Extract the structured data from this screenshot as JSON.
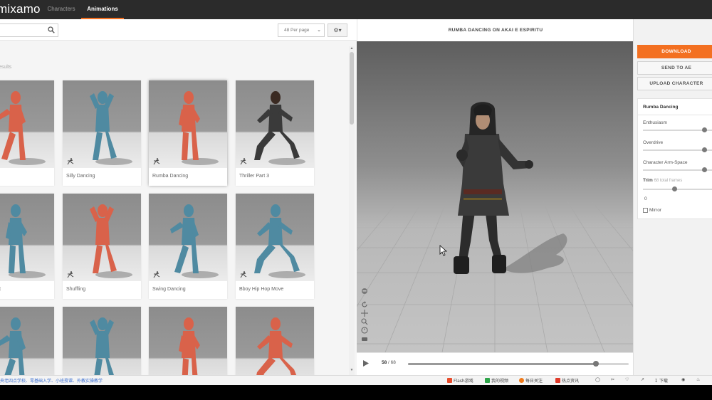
{
  "app": {
    "logo": "mixamo",
    "nav": [
      {
        "label": "Characters"
      },
      {
        "label": "Animations"
      }
    ]
  },
  "library": {
    "search_value": "",
    "per_page": "48 Per page",
    "results_label": "esults",
    "cards": [
      {
        "label": "Dancing",
        "tint": "orange",
        "pose": "lean"
      },
      {
        "label": "Silly Dancing",
        "tint": "blue",
        "pose": "arms-up"
      },
      {
        "label": "Rumba Dancing",
        "tint": "orange",
        "pose": "stand",
        "selected": true
      },
      {
        "label": "Thriller Part 3",
        "tint": "human",
        "pose": "crouch"
      },
      {
        "label": "rock Start",
        "tint": "blue",
        "pose": "stand"
      },
      {
        "label": "Shuffling",
        "tint": "orange",
        "pose": "arms-up"
      },
      {
        "label": "Swing Dancing",
        "tint": "blue",
        "pose": "lean"
      },
      {
        "label": "Bboy Hip Hop Move",
        "tint": "blue",
        "pose": "crouch"
      },
      {
        "label": "",
        "tint": "blue",
        "pose": "lean"
      },
      {
        "label": "",
        "tint": "blue",
        "pose": "arms-up"
      },
      {
        "label": "",
        "tint": "orange",
        "pose": "stand"
      },
      {
        "label": "",
        "tint": "orange",
        "pose": "crouch"
      }
    ]
  },
  "viewer": {
    "title": "RUMBA DANCING ON AKAI E ESPIRITU",
    "frame_current": "58",
    "frame_total": "/ 68",
    "progress": 0.85,
    "tools": [
      "head-icon",
      "reset-icon",
      "pan-icon",
      "zoom-icon",
      "timer-icon",
      "camera-icon"
    ]
  },
  "panel": {
    "download": "DOWNLOAD",
    "send_to": "SEND TO AE",
    "upload": "UPLOAD CHARACTER",
    "anim_name": "Rumba Dancing",
    "params": [
      {
        "label": "Enthusiasm",
        "value": 0.86
      },
      {
        "label": "Overdrive",
        "value": 0.86
      },
      {
        "label": "Character Arm-Space",
        "value": 0.86
      }
    ],
    "trim_label": "Trim",
    "trim_note": "68 total frames",
    "trim_start": 0.44,
    "trim_value": "0",
    "mirror_label": "Mirror"
  },
  "taskbar": {
    "ticker": "央老四点学校、零基础入学、小班授课、外教实操教学",
    "items": [
      "Flash游戏",
      "我的视频",
      "每日关注",
      "热点资讯",
      "下载"
    ]
  },
  "colors": {
    "accent": "#f37021",
    "blue_dummy": "#4f8aa1",
    "orange_dummy": "#d9624a"
  }
}
